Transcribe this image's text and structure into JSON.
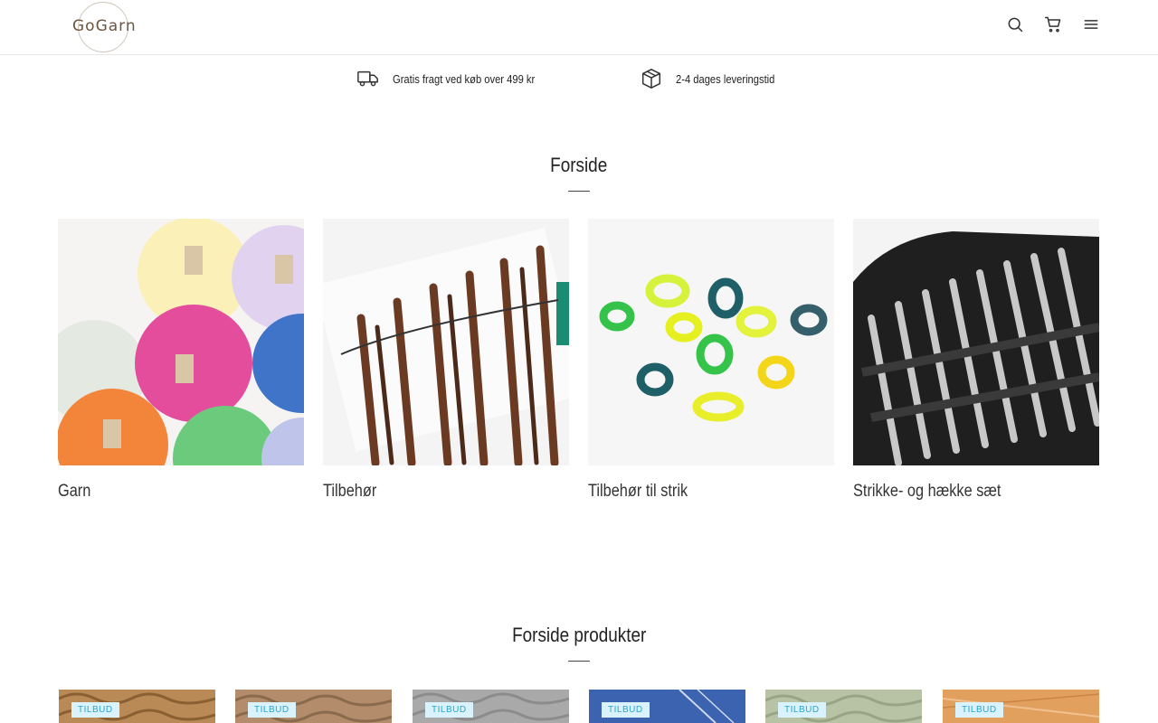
{
  "header": {
    "logo_text": "GoGarn",
    "icons": [
      "search-icon",
      "cart-icon",
      "menu-icon"
    ]
  },
  "usp": [
    {
      "icon": "truck-icon",
      "text": "Gratis fragt ved køb over 499 kr"
    },
    {
      "icon": "package-icon",
      "text": "2-4 dages leveringstid"
    }
  ],
  "categories_section": {
    "title": "Forside",
    "items": [
      {
        "label": "Garn"
      },
      {
        "label": "Tilbehør"
      },
      {
        "label": "Tilbehør til strik"
      },
      {
        "label": "Strikke- og hække sæt"
      }
    ]
  },
  "products_section": {
    "title": "Forside produkter",
    "badge": "TILBUD",
    "items": [
      {
        "badge": "TILBUD",
        "color": "#b98a55"
      },
      {
        "badge": "TILBUD",
        "color": "#b28c6b"
      },
      {
        "badge": "TILBUD",
        "color": "#a9a9a9"
      },
      {
        "badge": "TILBUD",
        "color": "#3c63b0"
      },
      {
        "badge": "TILBUD",
        "color": "#b7c3a4"
      },
      {
        "badge": "TILBUD",
        "color": "#e2a05f"
      }
    ]
  }
}
